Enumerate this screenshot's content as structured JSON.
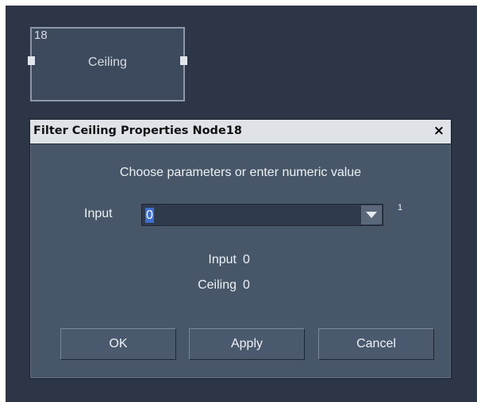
{
  "node": {
    "id": "18",
    "label": "Ceiling"
  },
  "dialog": {
    "title": "Filter Ceiling Properties Node18",
    "close_glyph": "×",
    "prompt": "Choose parameters or enter numeric value",
    "input_label": "Input",
    "input_value": "0",
    "input_superscript": "1",
    "info": [
      {
        "label": "Input",
        "value": "0"
      },
      {
        "label": "Ceiling",
        "value": "0"
      }
    ],
    "buttons": {
      "ok": "OK",
      "apply": "Apply",
      "cancel": "Cancel"
    }
  },
  "colors": {
    "canvas": "#2c3646",
    "dialog_body": "#475669",
    "titlebar": "#dfe3e8",
    "selection": "#3d6fd0"
  }
}
